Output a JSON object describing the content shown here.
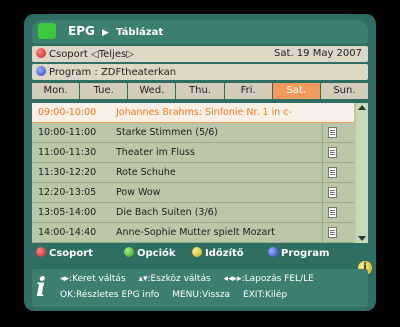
{
  "header": {
    "title": "EPG",
    "subtitle": "Táblázat"
  },
  "group": {
    "label": "Csoport",
    "value": "Teljes"
  },
  "date": "Sat. 19 May 2007",
  "program": {
    "label": "Program",
    "value": "ZDFtheaterkan"
  },
  "days": [
    "Mon.",
    "Tue.",
    "Wed.",
    "Thu.",
    "Fri.",
    "Sat.",
    "Sun."
  ],
  "selected_day": "Sat.",
  "events": [
    {
      "time": "09:00-10:00",
      "title": "Johannes Brahms: Sinfonie Nr. 1 in c-",
      "doc": false
    },
    {
      "time": "10:00-11:00",
      "title": "Starke Stimmen (5/6)",
      "doc": true
    },
    {
      "time": "11:00-11:30",
      "title": "Theater im Fluss",
      "doc": true
    },
    {
      "time": "11:30-12:20",
      "title": "Rote Schuhe",
      "doc": true
    },
    {
      "time": "12:20-13:05",
      "title": "Pow Wow",
      "doc": true
    },
    {
      "time": "13:05-14:00",
      "title": "Die Bach Suiten (3/6)",
      "doc": true
    },
    {
      "time": "14:00-14:40",
      "title": "Anne-Sophie Mutter spielt Mozart",
      "doc": true
    }
  ],
  "color_keys": {
    "red": "Csoport",
    "green": "Opciók",
    "yellow": "Időzítő",
    "blue": "Program"
  },
  "help": {
    "line1": [
      "◂▸:Keret váltás",
      "▴▾:Eszköz váltás",
      "◂◂▸▸:Lapozás FEL/LE"
    ],
    "line2": [
      "OK:Részletes EPG info",
      "MENU:Vissza",
      "EXIT:Kilép"
    ]
  }
}
